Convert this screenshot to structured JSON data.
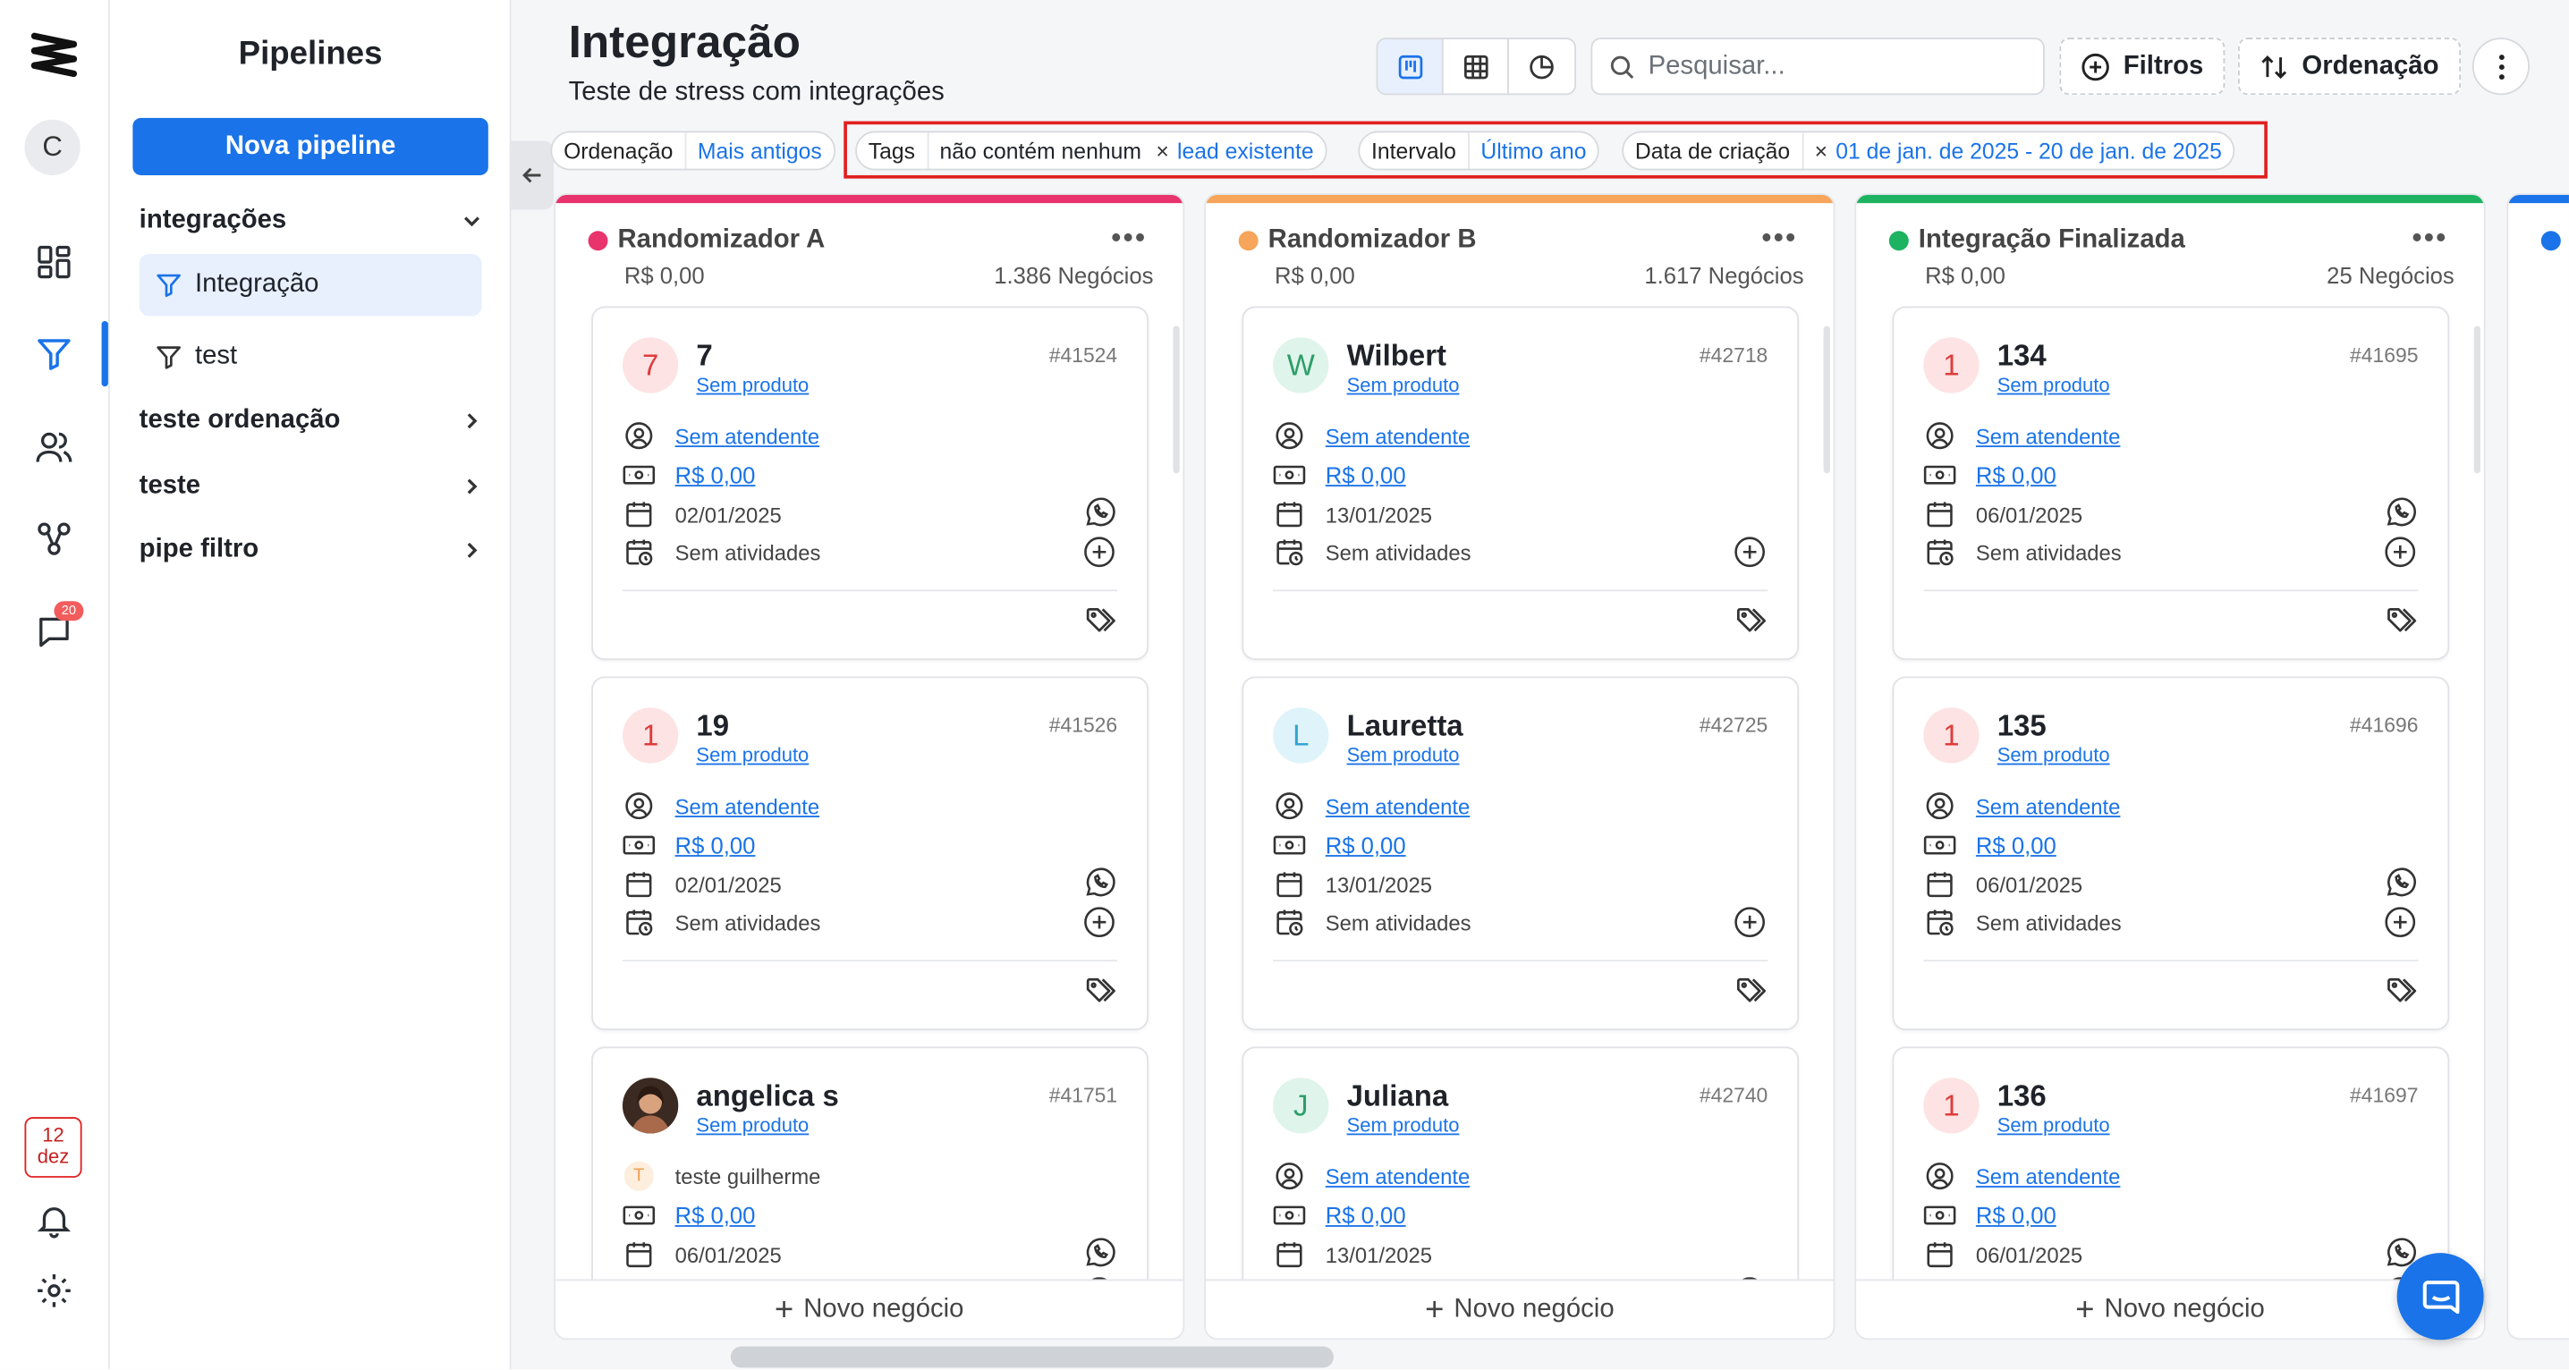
{
  "rail": {
    "avatar_letter": "C",
    "chat_badge": "20",
    "calendar_day": "12",
    "calendar_month": "dez"
  },
  "sidebar": {
    "title": "Pipelines",
    "new_button": "Nova pipeline",
    "groups": [
      {
        "label": "integrações",
        "expanded": true,
        "items": [
          "Integração",
          "test"
        ]
      },
      {
        "label": "teste ordenação",
        "expanded": false
      },
      {
        "label": "teste",
        "expanded": false
      },
      {
        "label": "pipe filtro",
        "expanded": false
      }
    ]
  },
  "header": {
    "title": "Integração",
    "subtitle": "Teste de stress com integrações"
  },
  "toolbar": {
    "search_placeholder": "Pesquisar...",
    "filters_label": "Filtros",
    "sort_label": "Ordenação"
  },
  "filters": [
    {
      "key": "Ordenação",
      "value": "Mais antigos"
    },
    {
      "key": "Tags",
      "operator": "não contém nenhum",
      "remove": "×",
      "value": "lead existente"
    },
    {
      "key": "Intervalo",
      "value": "Último ano"
    },
    {
      "key": "Data de criação",
      "remove": "×",
      "value": "01 de jan. de 2025 - 20 de jan. de 2025"
    }
  ],
  "columns": [
    {
      "name": "Randomizador A",
      "color": "#e8336d",
      "amount": "R$ 0,00",
      "count": "1.386 Negócios",
      "add_label": "Novo negócio",
      "cards": [
        {
          "avatar": "7",
          "avatar_bg": "#fde3e3",
          "avatar_fg": "#e03b3b",
          "name": "7",
          "product": "Sem produto",
          "id": "#41524",
          "agent": "Sem atendente",
          "value": "R$ 0,00",
          "date": "02/01/2025",
          "activities": "Sem atividades"
        },
        {
          "avatar": "1",
          "avatar_bg": "#fde3e3",
          "avatar_fg": "#e03b3b",
          "name": "19",
          "product": "Sem produto",
          "id": "#41526",
          "agent": "Sem atendente",
          "value": "R$ 0,00",
          "date": "02/01/2025",
          "activities": "Sem atividades"
        },
        {
          "avatar": "",
          "avatar_bg": "#7a5a48",
          "avatar_fg": "#ffffff",
          "name": "angelica s",
          "product": "Sem produto",
          "id": "#41751",
          "agent_initial": "T",
          "agent": "teste guilherme",
          "value": "R$ 0,00",
          "date": "06/01/2025"
        }
      ]
    },
    {
      "name": "Randomizador B",
      "color": "#f6a55a",
      "amount": "R$ 0,00",
      "count": "1.617 Negócios",
      "add_label": "Novo negócio",
      "cards": [
        {
          "avatar": "W",
          "avatar_bg": "#dff4ea",
          "avatar_fg": "#2e9e6a",
          "name": "Wilbert",
          "product": "Sem produto",
          "id": "#42718",
          "agent": "Sem atendente",
          "value": "R$ 0,00",
          "date": "13/01/2025",
          "activities": "Sem atividades"
        },
        {
          "avatar": "L",
          "avatar_bg": "#dff3fa",
          "avatar_fg": "#33a6d1",
          "name": "Lauretta",
          "product": "Sem produto",
          "id": "#42725",
          "agent": "Sem atendente",
          "value": "R$ 0,00",
          "date": "13/01/2025",
          "activities": "Sem atividades"
        },
        {
          "avatar": "J",
          "avatar_bg": "#dff4ea",
          "avatar_fg": "#2e9e6a",
          "name": "Juliana",
          "product": "Sem produto",
          "id": "#42740",
          "agent": "Sem atendente",
          "value": "R$ 0,00",
          "date": "13/01/2025"
        }
      ]
    },
    {
      "name": "Integração Finalizada",
      "color": "#1db361",
      "amount": "R$ 0,00",
      "count": "25 Negócios",
      "add_label": "Novo negócio",
      "cards": [
        {
          "avatar": "1",
          "avatar_bg": "#fde3e3",
          "avatar_fg": "#e03b3b",
          "name": "134",
          "product": "Sem produto",
          "id": "#41695",
          "agent": "Sem atendente",
          "value": "R$ 0,00",
          "date": "06/01/2025",
          "activities": "Sem atividades"
        },
        {
          "avatar": "1",
          "avatar_bg": "#fde3e3",
          "avatar_fg": "#e03b3b",
          "name": "135",
          "product": "Sem produto",
          "id": "#41696",
          "agent": "Sem atendente",
          "value": "R$ 0,00",
          "date": "06/01/2025",
          "activities": "Sem atividades"
        },
        {
          "avatar": "1",
          "avatar_bg": "#fde3e3",
          "avatar_fg": "#e03b3b",
          "name": "136",
          "product": "Sem produto",
          "id": "#41697",
          "agent": "Sem atendente",
          "value": "R$ 0,00",
          "date": "06/01/2025"
        }
      ]
    }
  ],
  "colors": {
    "accent": "#1a73e8",
    "highlight_box": "#e02020"
  }
}
